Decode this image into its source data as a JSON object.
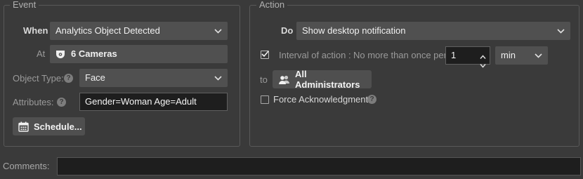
{
  "event": {
    "legend": "Event",
    "when_label": "When",
    "when_value": "Analytics Object Detected",
    "at_label": "At",
    "at_value": "6 Cameras",
    "object_type_label": "Object Type:",
    "object_type_value": "Face",
    "attributes_label": "Attributes:",
    "attributes_value": "Gender=Woman Age=Adult",
    "schedule_label": "Schedule...",
    "help_glyph": "?"
  },
  "action": {
    "legend": "Action",
    "do_label": "Do",
    "do_value": "Show desktop notification",
    "interval_label": "Interval of action :",
    "interval_prefix": "No more than once per",
    "interval_value": "1",
    "interval_unit": "min",
    "interval_checked": true,
    "to_label": "to",
    "to_value": "All Administrators",
    "force_ack_label": "Force Acknowledgment",
    "force_ack_checked": false,
    "help_glyph": "?"
  },
  "comments": {
    "label": "Comments:",
    "value": ""
  },
  "icons": {
    "camera": "camera-icon",
    "calendar": "calendar-icon",
    "users": "users-icon",
    "chevron": "chevron-down-icon",
    "help": "help-icon"
  },
  "colors": {
    "background": "#3a3a3a",
    "field": "#505050",
    "text_field": "#1e1e1e",
    "group_border": "#595959"
  }
}
